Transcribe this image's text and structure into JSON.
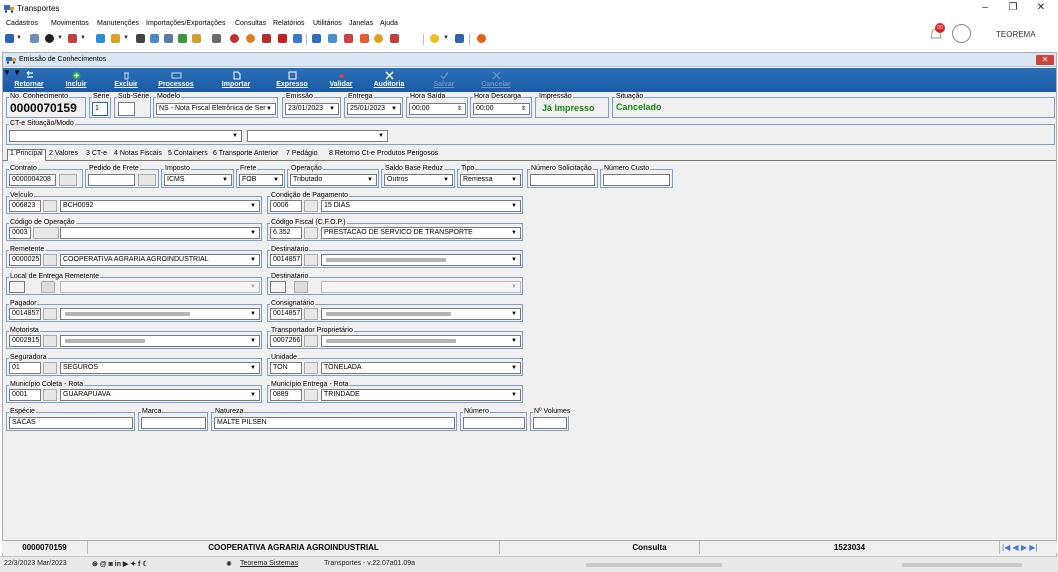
{
  "window": {
    "title": "Transportes",
    "minimize": "–",
    "restore": "❐",
    "close": "✕"
  },
  "menu": [
    "Cadastros",
    "Movimentos",
    "Manutenções",
    "Importações/Exportações",
    "Consultas",
    "Relatórios",
    "Utilitários",
    "Janelas",
    "Ajuda"
  ],
  "user": {
    "name": "TEOREMA",
    "notifications": "00"
  },
  "form": {
    "title": "Emissão de Conhecimentos",
    "close": "✕",
    "toolbar": {
      "retornar": "Retornar",
      "incluir": "Incluir",
      "excluir": "Excluir",
      "processos": "Processos",
      "importar": "Importar",
      "expresso": "Expresso",
      "validar": "Validar",
      "auditoria": "Auditoria",
      "salvar": "Salvar",
      "cancelar": "Cancelar"
    },
    "header": {
      "conhecimento_label": "No. Conhecimento",
      "conhecimento": "0000070159",
      "serie_label": "Série",
      "serie": "1",
      "subserie_label": "Sub-Série",
      "subserie": "",
      "modelo_label": "Modelo",
      "modelo": "NS - Nota Fiscal Eletrônica de Ser",
      "emissao_label": "Emissão",
      "emissao": "23/01/2023",
      "entrega_label": "Entrega",
      "entrega": "25/01/2023",
      "hora_saida_label": "Hora Saída",
      "hora_saida": "00:00",
      "hora_descarga_label": "Hora Descarga",
      "hora_descarga": "00:00",
      "impressao_label": "Impressão",
      "impressao": "Já Impresso",
      "situacao_label": "Situação",
      "situacao": "Cancelado"
    },
    "cte_label": "CT-e Situação/Modo",
    "tabs": [
      "1 Principal",
      "2 Valores",
      "3 CT-e",
      "4 Notas Fiscais",
      "5 Containers",
      "6 Transporte Anterior",
      "7 Pedágio",
      "8 Retorno Ct-e",
      "Produtos Perigosos"
    ],
    "principal": {
      "contrato_label": "Contrato",
      "contrato": "0000004208",
      "pedido_label": "Pedido de Frete",
      "pedido": "",
      "imposto_label": "Imposto",
      "imposto": "ICMS",
      "frete_label": "Frete",
      "frete": "FOB",
      "operacao_label": "Operação",
      "operacao": "Tributado",
      "saldo_label": "Saldo Base Reduz",
      "saldo": "Outros",
      "tipo_label": "Tipo",
      "tipo": "Remessa",
      "num_solicitacao_label": "Número Solicitação",
      "num_solicitacao": "",
      "num_custo_label": "Número Custo",
      "num_custo": "",
      "veiculo_label": "Veículo",
      "veiculo_code": "006823",
      "veiculo_name": "BCH0092",
      "condicao_label": "Condição de Pagamento",
      "condicao_code": "0006",
      "condicao_name": "15 DIAS",
      "codop_label": "Código de Operação",
      "codop_code": "0003",
      "codop_name": "",
      "cfop_label": "Código Fiscal (C.F.O.P.)",
      "cfop_code": "6.352",
      "cfop_name": "PRESTACAO DE SERVICO DE TRANSPORTE",
      "remetente_label": "Remetente",
      "remetente_code": "0000025",
      "remetente_name": "COOPERATIVA AGRARIA AGROINDUSTRIAL",
      "destinatario_label": "Destinatario",
      "destinatario_code": "0014857",
      "local_entrega_label": "Local de Entrega Remetente",
      "destinatario2_label": "Destinatario",
      "pagador_label": "Pagador",
      "pagador_code": "0014857",
      "consignatario_label": "Consignatário",
      "consignatario_code": "0014857",
      "motorista_label": "Motorista",
      "motorista_code": "0002915",
      "transportador_label": "Transportador Proprietário",
      "transportador_code": "0007266",
      "seguradora_label": "Seguradora",
      "seguradora_code": "01",
      "seguradora_name": "SEGUROS",
      "unidade_label": "Unidade",
      "unidade_code": "TON",
      "unidade_name": "TONELADA",
      "mun_coleta_label": "Município Coleta - Rota",
      "mun_coleta_code": "0001",
      "mun_coleta_name": "GUARAPUAVA",
      "mun_entrega_label": "Município Entrega - Rota",
      "mun_entrega_code": "0889",
      "mun_entrega_name": "TRINDADE",
      "especie_label": "Espécie",
      "especie": "SACAS",
      "marca_label": "Marca",
      "marca": "",
      "natureza_label": "Natureza",
      "natureza": "MALTE PILSEN",
      "numero_label": "Número",
      "numero": "",
      "volumes_label": "Nº Volumes",
      "volumes": ""
    },
    "statusbar": {
      "conhecimento": "0000070159",
      "empresa": "COOPERATIVA AGRARIA AGROINDUSTRIAL",
      "modo": "Consulta",
      "registro": "1523034"
    }
  },
  "footer": {
    "date": "22/3/2023 Mar/2023",
    "link": "Teorema Sistemas",
    "version": "Transportes - v.22.07a01.09a"
  },
  "colors": {
    "ribbon": "#1f62ad",
    "impressao": "#1a8a1a",
    "situacao": "#1a8a1a",
    "frame": "#7ea0c9"
  }
}
